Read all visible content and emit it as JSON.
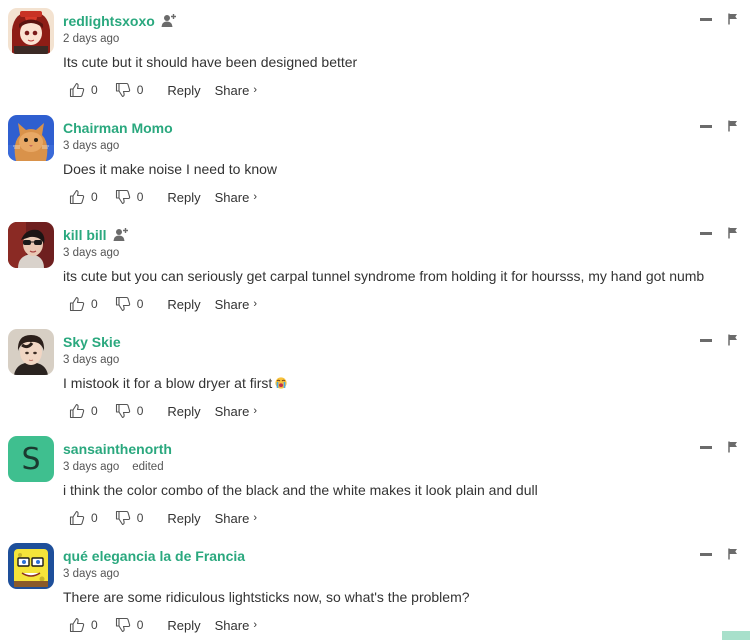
{
  "colors": {
    "username": "#2aa87e",
    "text": "#333333",
    "meta": "#555555",
    "icon": "#6b6b6b",
    "letter_avatar_bg": "#3fbf8f"
  },
  "labels": {
    "reply": "Reply",
    "share": "Share",
    "share_chevron": "›"
  },
  "comments": [
    {
      "username": "redlightsxoxo",
      "time": "2 days ago",
      "edited": "",
      "text": "Its cute but it should have been designed better",
      "likes": "0",
      "dislikes": "0",
      "follow_icon": true,
      "avatar_icon": "red-costume-character-avatar"
    },
    {
      "username": "Chairman Momo",
      "time": "3 days ago",
      "edited": "",
      "text": "Does it make noise I need to know",
      "likes": "0",
      "dislikes": "0",
      "follow_icon": false,
      "avatar_icon": "orange-cat-avatar"
    },
    {
      "username": "kill bill",
      "time": "3 days ago",
      "edited": "",
      "text": "its cute but you can seriously get carpal tunnel syndrome from holding it for hoursss, my hand got numb",
      "likes": "0",
      "dislikes": "0",
      "follow_icon": true,
      "avatar_icon": "person-sunglasses-avatar"
    },
    {
      "username": "Sky Skie",
      "time": "3 days ago",
      "edited": "",
      "text": "I mistook it for a blow dryer at first",
      "emoji": "crying-face-emoji",
      "likes": "0",
      "dislikes": "0",
      "follow_icon": false,
      "avatar_icon": "person-portrait-avatar"
    },
    {
      "username": "sansainthenorth",
      "time": "3 days ago",
      "edited": "edited",
      "text": "i think the color combo of the black and the white makes it look plain and dull",
      "likes": "0",
      "dislikes": "0",
      "follow_icon": false,
      "avatar_letter": "S"
    },
    {
      "username": "qué elegancia la de Francia",
      "time": "3 days ago",
      "edited": "",
      "text": "There are some ridiculous lightsticks now, so what's the problem?",
      "likes": "0",
      "dislikes": "0",
      "follow_icon": false,
      "avatar_icon": "cartoon-sponge-avatar"
    }
  ]
}
